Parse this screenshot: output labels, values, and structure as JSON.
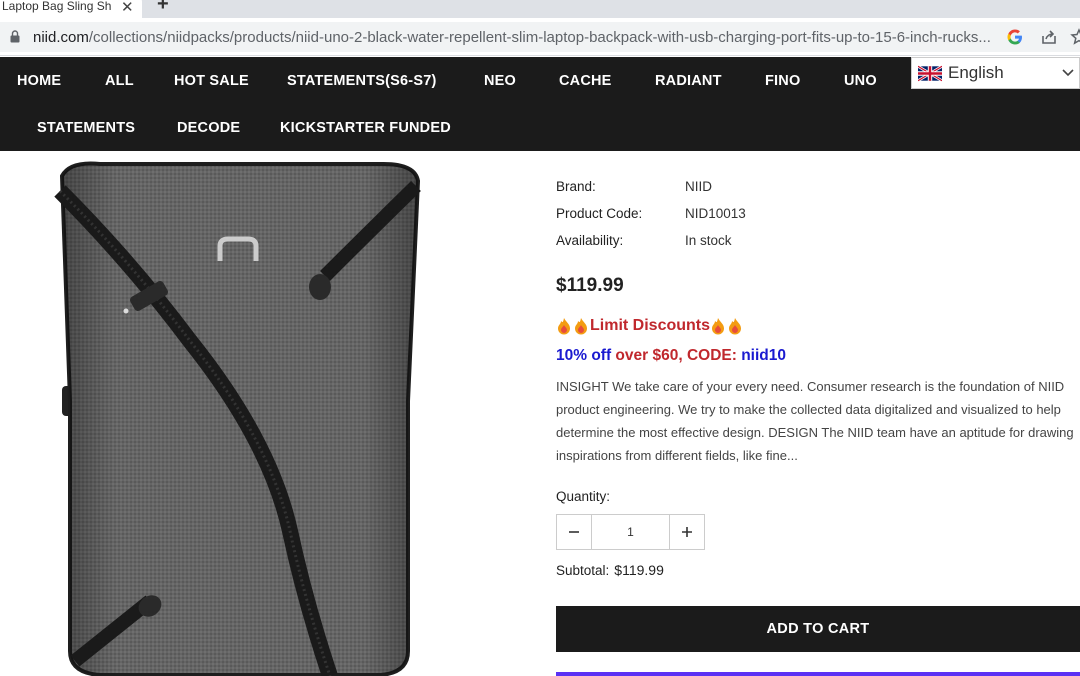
{
  "browser": {
    "tab_title": "Laptop Bag Sling Sh",
    "url_host": "niid.com",
    "url_path": "/collections/niidpacks/products/niid-uno-2-black-water-repellent-slim-laptop-backpack-with-usb-charging-port-fits-up-to-15-6-inch-rucks..."
  },
  "nav": {
    "row1": [
      "HOME",
      "ALL",
      "HOT SALE",
      "STATEMENTS(S6-S7)",
      "NEO",
      "CACHE",
      "RADIANT",
      "FINO",
      "UNO"
    ],
    "row2": [
      "STATEMENTS",
      "DECODE",
      "KICKSTARTER FUNDED"
    ],
    "language": "English"
  },
  "product": {
    "meta": [
      {
        "label": "Brand:",
        "value": "NIID"
      },
      {
        "label": "Product Code:",
        "value": "NID10013"
      },
      {
        "label": "Availability:",
        "value": "In stock"
      }
    ],
    "price": "$119.99",
    "promo_text": "Limit Discounts",
    "promo2_off": "10% off",
    "promo2_over": " over $60, CODE: ",
    "promo2_code": "niid10",
    "description": "INSIGHT We take care of your every need. Consumer research is the foundation of NIID product engineering. We try to make the collected data digitalized and visualized to help determine the most effective design. DESIGN The NIID team have an aptitude for drawing inspirations from different fields, like fine...",
    "quantity_label": "Quantity:",
    "quantity_value": "1",
    "subtotal_label": "Subtotal:",
    "subtotal_value": "$119.99",
    "add_to_cart": "ADD TO CART"
  },
  "colors": {
    "nav_bg": "#1b1b1b",
    "promo_red": "#c0282d",
    "promo_blue": "#1a1ad0",
    "buy_bar": "#5a31f4"
  }
}
